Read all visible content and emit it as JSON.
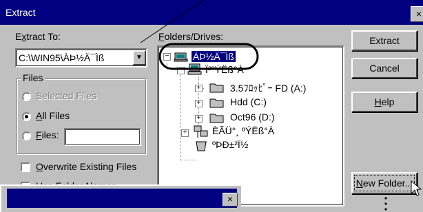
{
  "window": {
    "title": "Extract",
    "close_glyph": "×"
  },
  "extract_to": {
    "label_pre": "E",
    "label_ul": "x",
    "label_post": "tract To:",
    "value": "C:\\WIN95\\ÀÞ½Ä¯Ìß",
    "dropdown_glyph": "▼"
  },
  "files_group": {
    "title": "Files",
    "selected_files": {
      "ul": "S",
      "rest": "elected Files",
      "enabled": false
    },
    "all_files": {
      "ul": "A",
      "rest": "ll Files",
      "checked": true
    },
    "files": {
      "ul": "F",
      "rest": "iles:",
      "value": ""
    }
  },
  "overwrite": {
    "ul": "O",
    "rest": "verwrite Existing Files",
    "checked": false
  },
  "use_folder_names_partial": "Use Folder Names",
  "folders_label": {
    "ul": "F",
    "rest": "olders/Drives:"
  },
  "tree": {
    "root": "ÀÞ½Ä¯Ìß",
    "my_computer": "Ï²ºÝËß­°À",
    "drive_a": "3.5ﾌﾛｯﾋﾟｰ FD (A:)",
    "drive_c": "Hdd (C:)",
    "drive_d": "Oct96 (D:)",
    "network": "ÈÃÜ°¸ ºÝËß­°À",
    "recycle": "ºÞÐ±²Ï½",
    "plus": "+",
    "minus": "−"
  },
  "buttons": {
    "extract": "Extract",
    "cancel": "Cancel",
    "help_ul": "H",
    "help_rest": "elp",
    "new_folder_ul": "N",
    "new_folder_rest": "ew Folder..."
  },
  "second_window": {
    "close_glyph": "×"
  }
}
